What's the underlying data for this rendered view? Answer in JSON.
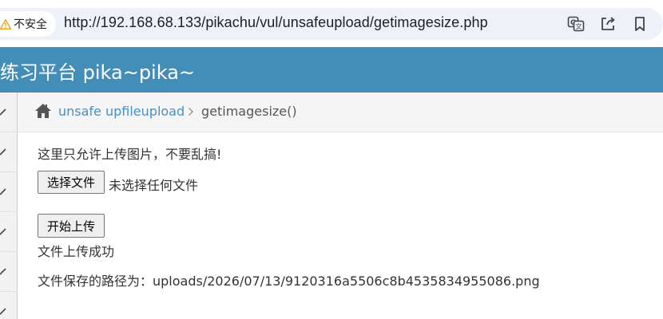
{
  "browser": {
    "security_label": "不安全",
    "url": "http://192.168.68.133/pikachu/vul/unsafeupload/getimagesize.php",
    "icons": [
      "translate-icon",
      "share-icon",
      "bookmark-icon"
    ]
  },
  "header": {
    "title": "练习平台 pika~pika~"
  },
  "breadcrumb": {
    "parent": "unsafe upfileupload",
    "current": "getimagesize()"
  },
  "content": {
    "notice": "这里只允许上传图片，不要乱搞!",
    "file_button_label": "选择文件",
    "file_status": "未选择任何文件",
    "upload_button_label": "开始上传",
    "result": "文件上传成功",
    "saved_path": "文件保存的路径为：uploads/2026/07/13/9120316a5506c8b4535834955086.png"
  },
  "colors": {
    "header_bg": "#438eb9",
    "link": "#4c8fbd",
    "warning": "#e8a317"
  }
}
